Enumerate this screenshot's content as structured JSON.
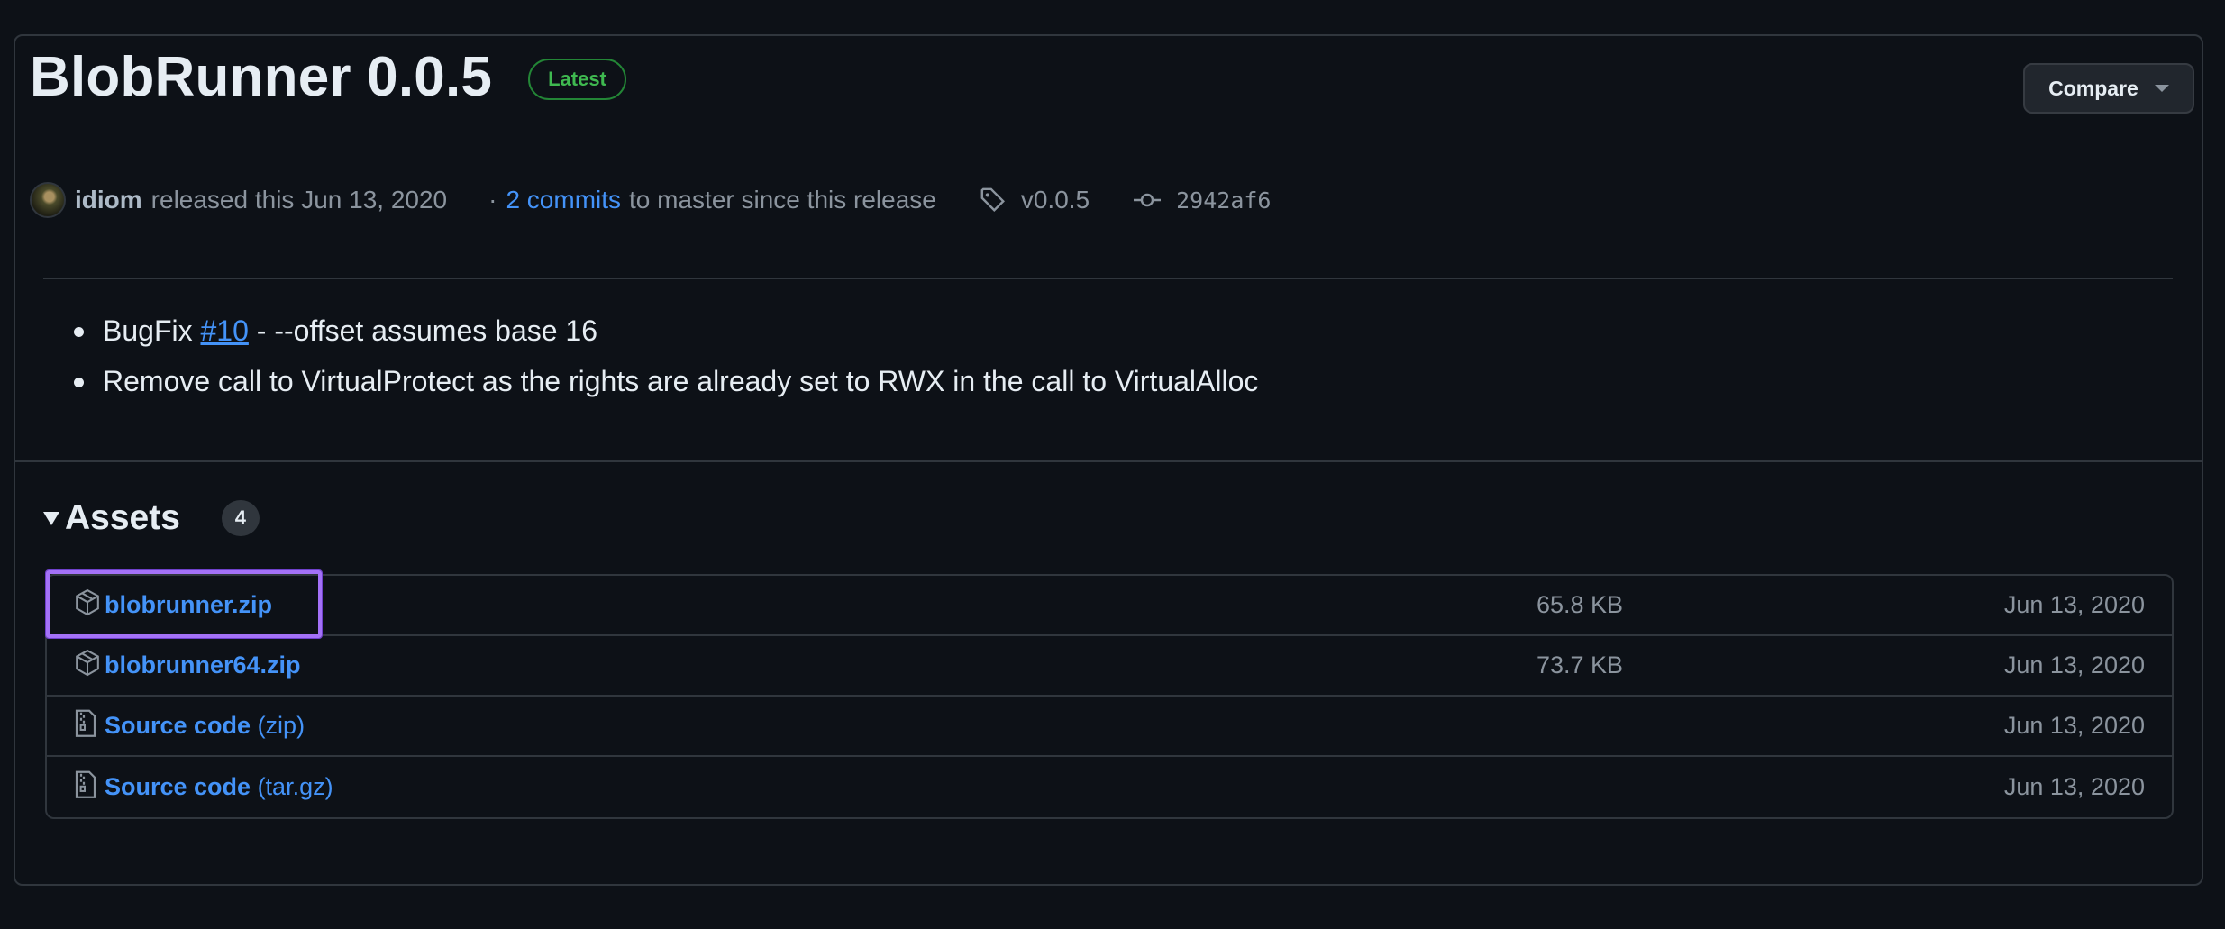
{
  "release": {
    "title": "BlobRunner 0.0.5",
    "latest_badge": "Latest",
    "compare_label": "Compare",
    "author": "idiom",
    "released_text": "released this Jun 13, 2020",
    "separator": "·",
    "commits_link": "2 commits",
    "commits_suffix": "to master since this release",
    "tag": "v0.0.5",
    "commit_sha": "2942af6"
  },
  "notes": [
    {
      "prefix": "BugFix ",
      "link": "#10",
      "suffix": " - --offset assumes base 16"
    },
    {
      "text": "Remove call to VirtualProtect as the rights are already set to RWX in the call to VirtualAlloc"
    }
  ],
  "assets": {
    "title": "Assets",
    "count": "4",
    "items": [
      {
        "name": "blobrunner.zip",
        "sub": "",
        "size": "65.8 KB",
        "date": "Jun 13, 2020",
        "icon": "package-icon"
      },
      {
        "name": "blobrunner64.zip",
        "sub": "",
        "size": "73.7 KB",
        "date": "Jun 13, 2020",
        "icon": "package-icon"
      },
      {
        "name": "Source code",
        "sub": " (zip)",
        "size": "",
        "date": "Jun 13, 2020",
        "icon": "file-zip-icon"
      },
      {
        "name": "Source code",
        "sub": " (tar.gz)",
        "size": "",
        "date": "Jun 13, 2020",
        "icon": "file-zip-icon"
      }
    ]
  },
  "colors": {
    "background": "#0d1117",
    "link": "#4493f8",
    "latest_green": "#3fb950",
    "highlight": "#a371f7"
  }
}
